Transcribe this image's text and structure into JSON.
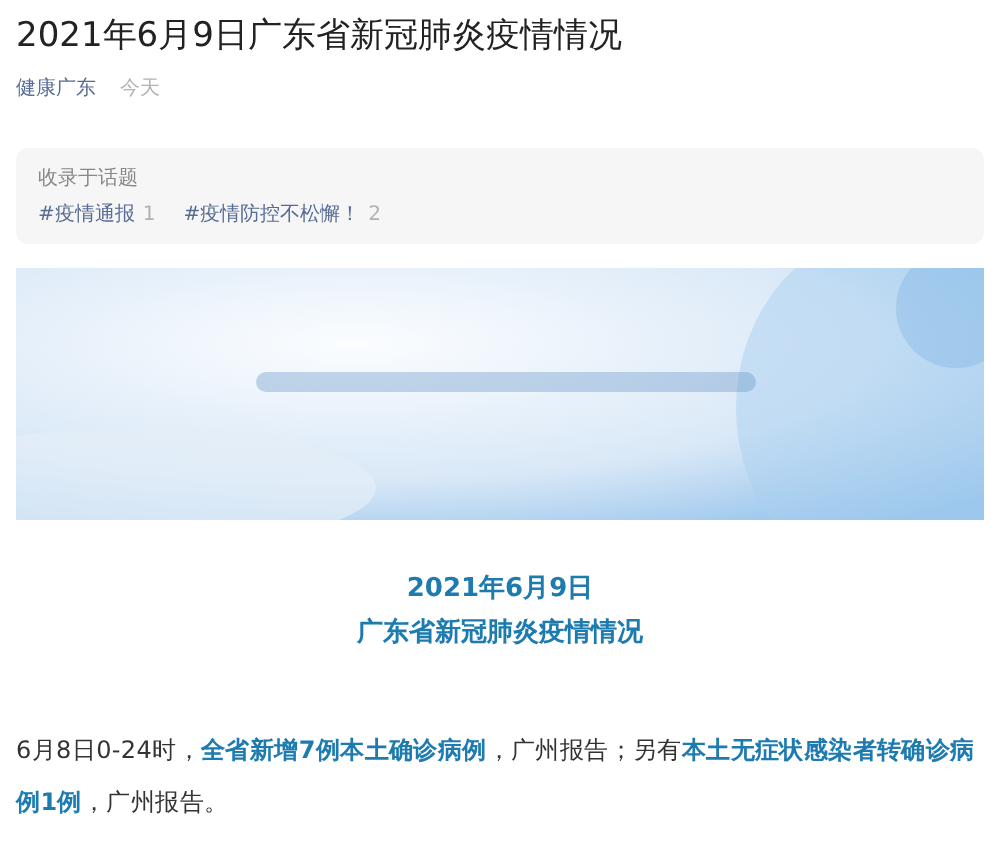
{
  "article": {
    "title": "2021年6月9日广东省新冠肺炎疫情情况",
    "author": "健康广东",
    "date": "今天"
  },
  "topics": {
    "label": "收录于话题",
    "tags": [
      {
        "name": "#疫情通报",
        "count": "1"
      },
      {
        "name": "#疫情防控不松懈！",
        "count": "2"
      }
    ]
  },
  "heading": [
    "2021年6月9日",
    "广东省新冠肺炎疫情情况"
  ],
  "paragraph": "6月8日0-24时，**全省新增7例本土确诊病例**，广州报告；另有**本土无症状感染者转确诊病例1例**，广州报告。"
}
